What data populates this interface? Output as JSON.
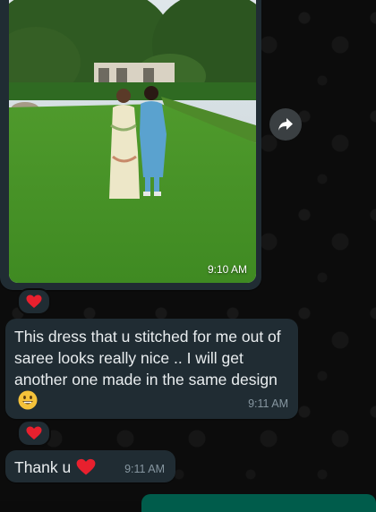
{
  "messages": [
    {
      "type": "image",
      "time": "9:10 AM",
      "reaction": "red-heart-icon",
      "image_description_icon": "photo"
    },
    {
      "type": "text",
      "text": "This dress that u stitched for me out of saree looks really nice .. I will get another one made in the same design",
      "emoji": "grinning-face-icon",
      "time": "9:11 AM",
      "reaction": "red-heart-icon"
    },
    {
      "type": "text",
      "text": "Thank u",
      "emoji": "red-heart-icon",
      "time": "9:11 AM"
    }
  ],
  "colors": {
    "incoming_bubble": "#202c33",
    "outgoing_bubble": "#005c4b",
    "timestamp": "#8696a0",
    "heart": "#e8202e"
  }
}
